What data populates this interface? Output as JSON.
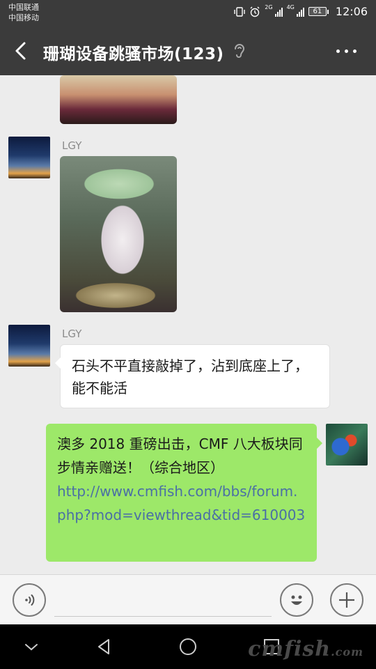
{
  "status_bar": {
    "carrier_1": "中国联通",
    "carrier_2": "中国移动",
    "network_1": "2G",
    "network_2": "4G",
    "battery": "61",
    "time": "12:06"
  },
  "header": {
    "title": "珊瑚设备跳骚市场(123)",
    "back_icon": "chevron-left-icon",
    "ear_icon": "ear-icon",
    "more_icon": "more-dots-icon"
  },
  "messages": {
    "m1": {
      "sender": "LGY",
      "avatar": "night-sky-avatar"
    },
    "m2": {
      "sender": "LGY",
      "avatar": "night-sky-avatar",
      "text": "石头不平直接敲掉了，沾到底座上了，能不能活"
    },
    "m3": {
      "avatar": "fish-avatar",
      "text": "澳多 2018 重磅出击，CMF 八大板块同步情亲赠送！（综合地区）",
      "link": "http://www.cmfish.com/bbs/forum.php?mod=viewthread&tid=610003"
    }
  },
  "input_bar": {
    "voice_icon": "voice-icon",
    "emoji_icon": "emoji-icon",
    "plus_icon": "plus-icon",
    "input_value": ""
  },
  "nav_bar": {
    "back_icon": "triangle-back-icon",
    "home_icon": "circle-home-icon",
    "recents_icon": "square-recents-icon",
    "watermark": "cmfish",
    "watermark_suffix": ".com"
  },
  "colors": {
    "header_bg": "#3b3b3b",
    "outgoing_bubble": "#9de869",
    "link": "#4a6fa5",
    "chat_bg": "#ececec"
  }
}
